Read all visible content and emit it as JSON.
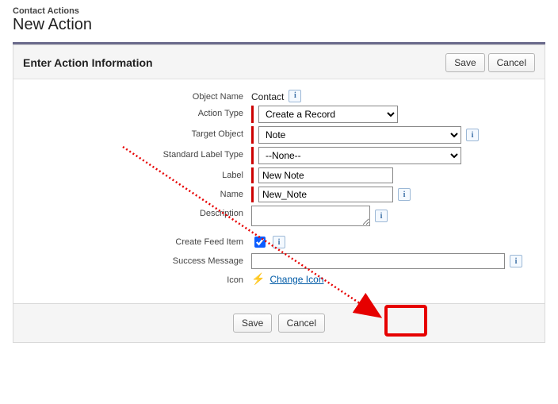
{
  "header": {
    "breadcrumb": "Contact Actions",
    "title": "New Action"
  },
  "section": {
    "title": "Enter Action Information",
    "save_label": "Save",
    "cancel_label": "Cancel"
  },
  "form": {
    "object_name": {
      "label": "Object Name",
      "value": "Contact"
    },
    "action_type": {
      "label": "Action Type",
      "value": "Create a Record"
    },
    "target_object": {
      "label": "Target Object",
      "value": "Note"
    },
    "standard_label_type": {
      "label": "Standard Label Type",
      "value": "--None--"
    },
    "label_field": {
      "label": "Label",
      "value": "New Note"
    },
    "name_field": {
      "label": "Name",
      "value": "New_Note"
    },
    "description": {
      "label": "Description",
      "value": ""
    },
    "create_feed_item": {
      "label": "Create Feed Item",
      "checked": true
    },
    "success_message": {
      "label": "Success Message",
      "value": ""
    },
    "icon": {
      "label": "Icon",
      "link_text": "Change Icon"
    }
  },
  "footer": {
    "save_label": "Save",
    "cancel_label": "Cancel"
  }
}
